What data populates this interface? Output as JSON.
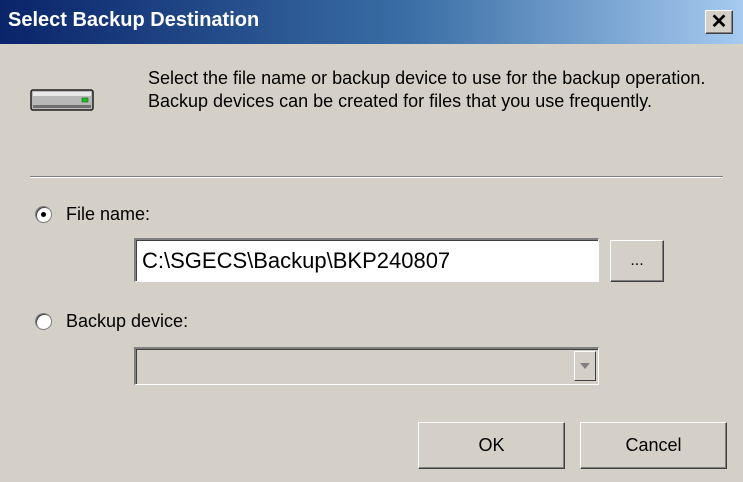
{
  "dialog": {
    "title": "Select Backup Destination",
    "close_label": "✕"
  },
  "description": "Select the file name or backup device to use for the backup operation.  Backup devices can be created for files that you use frequently.",
  "options": {
    "file_name_label": "File name:",
    "file_name_selected": true,
    "file_name_value": "C:\\SGECS\\Backup\\BKP240807",
    "browse_label": "...",
    "backup_device_label": "Backup device:",
    "backup_device_selected": false,
    "backup_device_value": ""
  },
  "buttons": {
    "ok": "OK",
    "cancel": "Cancel"
  },
  "icons": {
    "drive": "hard-drive-icon",
    "dropdown": "chevron-down-icon"
  },
  "colors": {
    "title_gradient_start": "#0a246a",
    "title_gradient_end": "#a6caf0",
    "dialog_bg": "#d4d0c8"
  }
}
